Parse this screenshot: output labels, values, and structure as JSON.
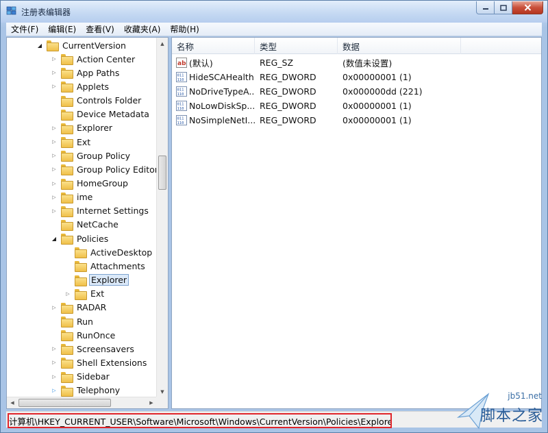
{
  "window": {
    "title": "注册表编辑器"
  },
  "menu": [
    "文件(F)",
    "编辑(E)",
    "查看(V)",
    "收藏夹(A)",
    "帮助(H)"
  ],
  "tree": {
    "root": {
      "label": "CurrentVersion",
      "expanded": true
    },
    "items": [
      {
        "label": "Action Center",
        "level": 1,
        "expander": "closed"
      },
      {
        "label": "App Paths",
        "level": 1,
        "expander": "closed"
      },
      {
        "label": "Applets",
        "level": 1,
        "expander": "closed"
      },
      {
        "label": "Controls Folder",
        "level": 1,
        "expander": "none"
      },
      {
        "label": "Device Metadata",
        "level": 1,
        "expander": "none"
      },
      {
        "label": "Explorer",
        "level": 1,
        "expander": "closed"
      },
      {
        "label": "Ext",
        "level": 1,
        "expander": "closed"
      },
      {
        "label": "Group Policy",
        "level": 1,
        "expander": "closed"
      },
      {
        "label": "Group Policy Editor",
        "level": 1,
        "expander": "closed"
      },
      {
        "label": "HomeGroup",
        "level": 1,
        "expander": "closed"
      },
      {
        "label": "ime",
        "level": 1,
        "expander": "closed"
      },
      {
        "label": "Internet Settings",
        "level": 1,
        "expander": "closed"
      },
      {
        "label": "NetCache",
        "level": 1,
        "expander": "none"
      },
      {
        "label": "Policies",
        "level": 1,
        "expander": "open"
      },
      {
        "label": "ActiveDesktop",
        "level": 2,
        "expander": "none"
      },
      {
        "label": "Attachments",
        "level": 2,
        "expander": "none"
      },
      {
        "label": "Explorer",
        "level": 2,
        "expander": "none",
        "selected": true
      },
      {
        "label": "Ext",
        "level": 2,
        "expander": "closed"
      },
      {
        "label": "RADAR",
        "level": 1,
        "expander": "closed"
      },
      {
        "label": "Run",
        "level": 1,
        "expander": "none"
      },
      {
        "label": "RunOnce",
        "level": 1,
        "expander": "none"
      },
      {
        "label": "Screensavers",
        "level": 1,
        "expander": "closed"
      },
      {
        "label": "Shell Extensions",
        "level": 1,
        "expander": "closed"
      },
      {
        "label": "Sidebar",
        "level": 1,
        "expander": "closed"
      },
      {
        "label": "Telephony",
        "level": 1,
        "expander": "blue"
      }
    ]
  },
  "list": {
    "columns": {
      "name": "名称",
      "type": "类型",
      "data": "数据"
    },
    "rows": [
      {
        "icon": "string-value-icon",
        "name": "(默认)",
        "type": "REG_SZ",
        "data": "(数值未设置)"
      },
      {
        "icon": "binary-value-icon",
        "name": "HideSCAHealth",
        "type": "REG_DWORD",
        "data": "0x00000001 (1)"
      },
      {
        "icon": "binary-value-icon",
        "name": "NoDriveTypeA...",
        "type": "REG_DWORD",
        "data": "0x000000dd (221)"
      },
      {
        "icon": "binary-value-icon",
        "name": "NoLowDiskSp...",
        "type": "REG_DWORD",
        "data": "0x00000001 (1)"
      },
      {
        "icon": "binary-value-icon",
        "name": "NoSimpleNetI...",
        "type": "REG_DWORD",
        "data": "0x00000001 (1)"
      }
    ]
  },
  "status": {
    "path": "计算机\\HKEY_CURRENT_USER\\Software\\Microsoft\\Windows\\CurrentVersion\\Policies\\Explorer"
  },
  "watermark": {
    "site": "jb51.net",
    "name": "脚本之家"
  },
  "colors": {
    "highlight": "#e0242a",
    "folder": "#f0c04a",
    "selection": "#dbe9f9"
  }
}
